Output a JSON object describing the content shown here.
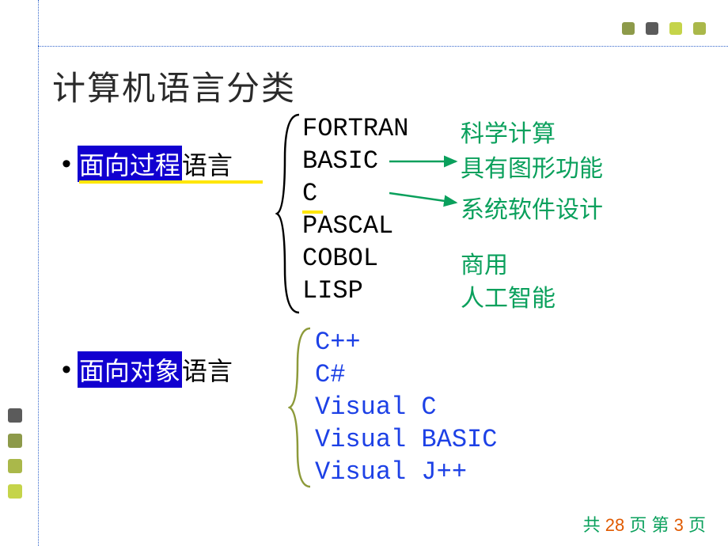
{
  "title": "计算机语言分类",
  "proc": {
    "label_hl": "面向过程",
    "label_tail": "语言",
    "langs": [
      "FORTRAN",
      "BASIC",
      "C",
      "PASCAL",
      "COBOL",
      "LISP"
    ]
  },
  "obj": {
    "label_hl": "面向对象",
    "label_tail": "语言",
    "langs": [
      "C++",
      "C#",
      "Visual C",
      "Visual BASIC",
      "Visual J++"
    ]
  },
  "purpose": {
    "fortran": "科学计算",
    "basic": "具有图形功能",
    "c": "系统软件设计",
    "cobol": "商用",
    "lisp": "人工智能"
  },
  "footer": {
    "prefix": "共",
    "total": "28",
    "mid": "页    第",
    "current": "3",
    "suffix": "页"
  }
}
